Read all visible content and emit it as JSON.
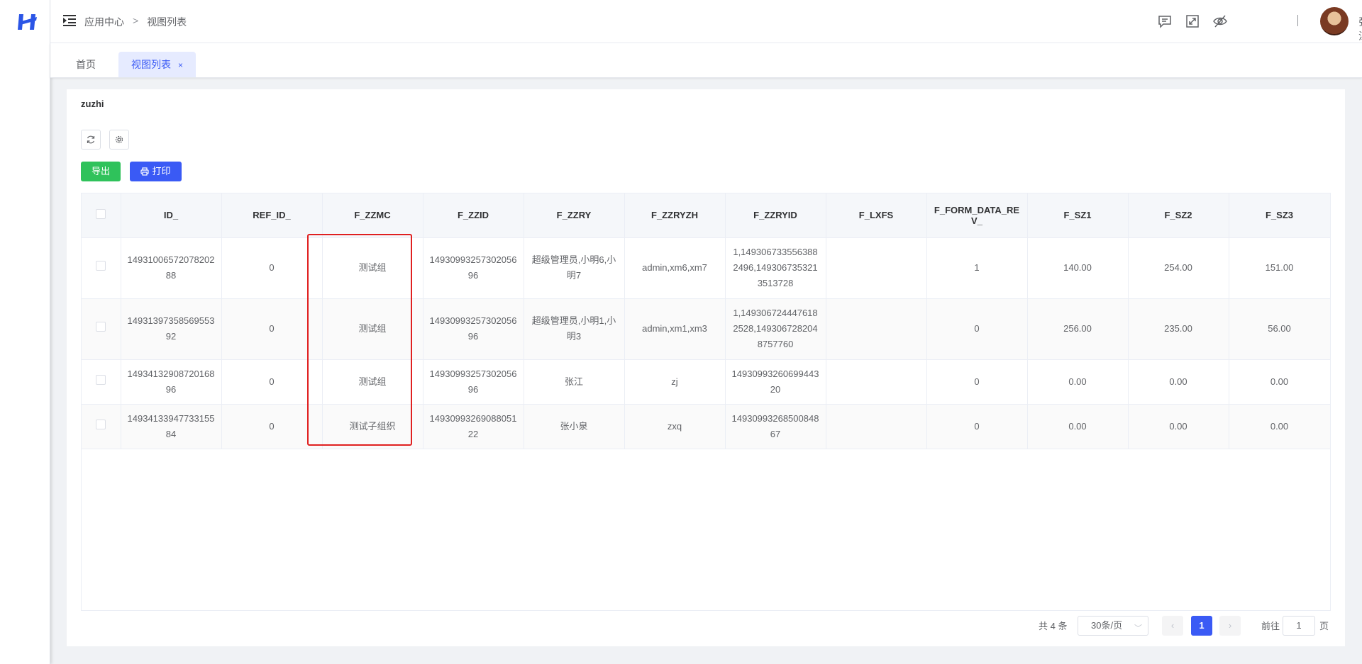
{
  "breadcrumb": {
    "root": "应用中心",
    "separator": ">",
    "current": "视图列表"
  },
  "user": {
    "name": "张江"
  },
  "tabs": [
    {
      "label": "首页",
      "active": false
    },
    {
      "label": "视图列表",
      "active": true,
      "close": "×"
    }
  ],
  "view": {
    "title": "zuzhi"
  },
  "buttons": {
    "export": "导出",
    "print": "打印"
  },
  "table": {
    "columns": [
      "ID_",
      "REF_ID_",
      "F_ZZMC",
      "F_ZZID",
      "F_ZZRY",
      "F_ZZRYZH",
      "F_ZZRYID",
      "F_LXFS",
      "F_FORM_DATA_REV_",
      "F_SZ1",
      "F_SZ2",
      "F_SZ3"
    ],
    "rows": [
      [
        "1493100657207820288",
        "0",
        "测试组",
        "1493099325730205696",
        "超级管理员,小明6,小明7",
        "admin,xm6,xm7",
        "1,1493067335563882496,1493067353213513728",
        "",
        "1",
        "140.00",
        "254.00",
        "151.00"
      ],
      [
        "1493139735856955392",
        "0",
        "测试组",
        "1493099325730205696",
        "超级管理员,小明1,小明3",
        "admin,xm1,xm3",
        "1,1493067244476182528,1493067282048757760",
        "",
        "0",
        "256.00",
        "235.00",
        "56.00"
      ],
      [
        "1493413290872016896",
        "0",
        "测试组",
        "1493099325730205696",
        "张江",
        "zj",
        "1493099326069944320",
        "",
        "0",
        "0.00",
        "0.00",
        "0.00"
      ],
      [
        "1493413394773315584",
        "0",
        "测试子组织",
        "1493099326908805122",
        "张小泉",
        "zxq",
        "1493099326850084867",
        "",
        "0",
        "0.00",
        "0.00",
        "0.00"
      ]
    ]
  },
  "pagination": {
    "total": "共 4 条",
    "page_size": "30条/页",
    "prev": "‹",
    "current": "1",
    "next": "›",
    "goto_label": "前往",
    "goto_value": "1",
    "page_suffix": "页"
  },
  "colors": {
    "primary": "#3a5af5",
    "success": "#2fc25b",
    "highlight": "#e02020"
  }
}
